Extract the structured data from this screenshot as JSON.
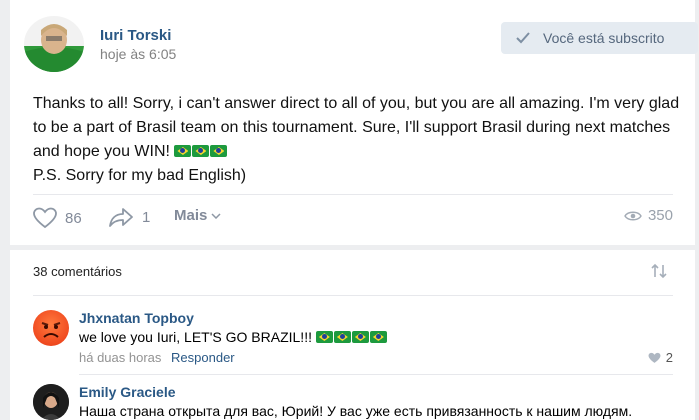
{
  "post": {
    "author": "Iuri Torski",
    "time": "hoje às 6:05",
    "subscribe_label": "Você está subscrito",
    "text_lines": [
      "Thanks to all! Sorry, i can't answer direct to all of you, but you are all amazing. I'm very glad",
      "to be a part of Brasil team on this tournament. Sure, I'll support Brasil during next matches",
      "and hope you WIN!",
      "P.S. Sorry for my bad English)"
    ],
    "likes": "86",
    "shares": "1",
    "more_label": "Mais",
    "views": "350"
  },
  "comments_section": {
    "count_label": "38 comentários"
  },
  "comments": [
    {
      "name": "Jhxnatan Topboy",
      "text": "we love you Iuri, LET'S GO BRAZIL!!!",
      "time": "há duas horas",
      "reply_label": "Responder",
      "likes": "2"
    },
    {
      "name": "Emily Graciele",
      "text": "Наша страна открыта для вас, Юрий! У вас уже есть привязанность к нашим людям."
    }
  ],
  "colors": {
    "link": "#2a5885",
    "muted": "#828a99",
    "button_bg": "#e5ebf1",
    "brazil_green": "#1d9a3e",
    "brazil_yellow": "#f6d630"
  },
  "icons": {
    "subscribed": "check-icon",
    "like": "heart-icon",
    "share": "share-arrow-icon",
    "more": "chevron-down-icon",
    "views": "eye-icon",
    "sort": "sort-arrows-icon",
    "flag": "brazil-flag-icon"
  }
}
